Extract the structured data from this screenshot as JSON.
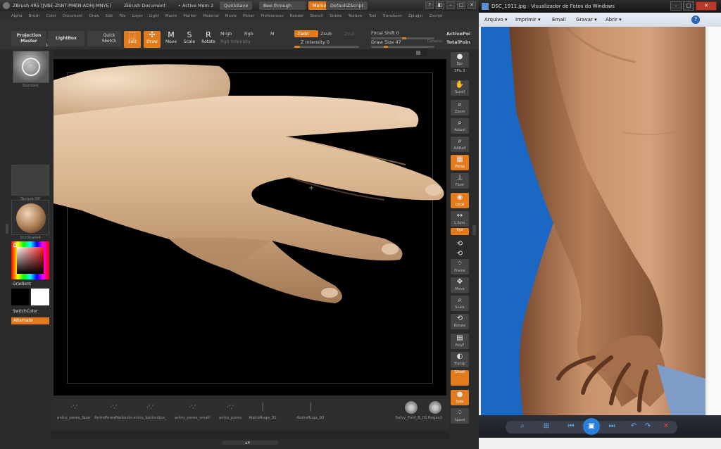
{
  "zbrush": {
    "title": "ZBrush 4R5 [JVBE-ZSNT-PMEN-ADHJ-MNYE]",
    "document": "ZBrush Document",
    "active_mem": "• Active Mem 2",
    "quicksave": "QuickSave",
    "seethrough": "See-through",
    "seethrough_val": "0",
    "menus": "Menus",
    "script": "DefaultZScript",
    "menu": [
      "Alpha",
      "Brush",
      "Color",
      "Document",
      "Draw",
      "Edit",
      "File",
      "Layer",
      "Light",
      "Macro",
      "Marker",
      "Material",
      "Movie",
      "Picker",
      "Preferences",
      "Render",
      "Stencil",
      "Stroke",
      "Texture",
      "Tool",
      "Transform",
      "Zplugin",
      "Zscript"
    ],
    "toolbar": {
      "projection_master": "Projection Master",
      "lightbox": "LightBox",
      "quick_sketch": "Quick Sketch",
      "edit": "Edit",
      "draw": "Draw",
      "move": "Move",
      "scale": "Scale",
      "rotate": "Rotate",
      "mrgb": "Mrgb",
      "rgb": "Rgb",
      "m": "M",
      "rgb_intensity": "Rgb  Intensity",
      "zadd": "Zadd",
      "zsub": "Zsub",
      "zcut": "Zcut",
      "z_intensity": "Z Intensity 0",
      "focal_shift": "Focal Shift 0",
      "draw_size": "Draw Size 47",
      "dynamic": "Dynamic",
      "active_points": "ActivePoi",
      "total_points": "TotalPoin"
    },
    "coords": "-0.191,0.027,0.849",
    "left": {
      "standard_label": "Standard",
      "texture_label": "Texture Off",
      "material_label": "SkinShade4",
      "gradient": "Gradient",
      "switchcolor": "SwitchColor",
      "alternate": "Alternate"
    },
    "right_shelf": [
      "Bpr",
      "SPix 3",
      "Scroll",
      "Zoom",
      "Actual",
      "AAHalf",
      "Persp",
      "Floor",
      "Local",
      "L.Sym",
      "Xyz",
      "",
      "",
      "Frame",
      "Move",
      "Scale",
      "Rotate",
      "PolyF",
      "Transp",
      "Ghost",
      "Solo",
      "Xpose"
    ],
    "alphas": [
      "antro_pores_Spar",
      "AntroPoresRedondo",
      "antro_bottonlips_",
      "antro_pores_small",
      "antro_pores",
      "AlphaRuga_01",
      "AlphaRuga_02",
      "Salvy_Fold_B_01",
      "Rugas2"
    ],
    "accent": "#e27b1c"
  },
  "viewer": {
    "title": "DSC_1911.jpg - Visualizador de Fotos do Windows",
    "menu": [
      "Arquivo ▾",
      "Imprimir ▾",
      "Email",
      "Gravar ▾",
      "Abrir ▾"
    ],
    "help": "?",
    "controls": [
      "search-icon",
      "slideshow-icon",
      "prev-icon",
      "play-icon",
      "next-icon",
      "rotate-ccw-icon",
      "rotate-cw-icon",
      "delete-icon"
    ],
    "win_buttons": [
      "–",
      "□",
      "✕"
    ]
  }
}
